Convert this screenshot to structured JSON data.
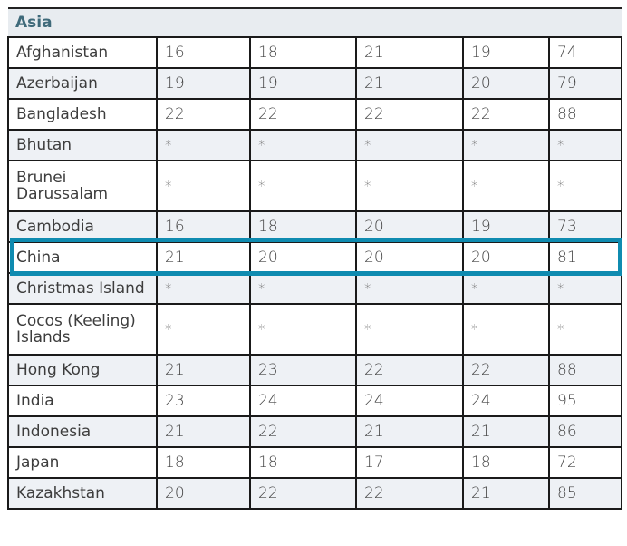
{
  "section_title": "Asia",
  "highlight_color": "#0f8bb0",
  "rows": [
    {
      "name": "Afghanistan",
      "values": [
        "16",
        "18",
        "21",
        "19",
        "74"
      ]
    },
    {
      "name": "Azerbaijan",
      "values": [
        "19",
        "19",
        "21",
        "20",
        "79"
      ]
    },
    {
      "name": "Bangladesh",
      "values": [
        "22",
        "22",
        "22",
        "22",
        "88"
      ]
    },
    {
      "name": "Bhutan",
      "values": [
        "*",
        "*",
        "*",
        "*",
        "*"
      ]
    },
    {
      "name": "Brunei Darussalam",
      "values": [
        "*",
        "*",
        "*",
        "*",
        "*"
      ]
    },
    {
      "name": "Cambodia",
      "values": [
        "16",
        "18",
        "20",
        "19",
        "73"
      ]
    },
    {
      "name": "China",
      "values": [
        "21",
        "20",
        "20",
        "20",
        "81"
      ],
      "highlighted": true
    },
    {
      "name": "Christmas Island",
      "values": [
        "*",
        "*",
        "*",
        "*",
        "*"
      ]
    },
    {
      "name": "Cocos (Keeling) Islands",
      "values": [
        "*",
        "*",
        "*",
        "*",
        "*"
      ]
    },
    {
      "name": "Hong Kong",
      "values": [
        "21",
        "23",
        "22",
        "22",
        "88"
      ]
    },
    {
      "name": "India",
      "values": [
        "23",
        "24",
        "24",
        "24",
        "95"
      ]
    },
    {
      "name": "Indonesia",
      "values": [
        "21",
        "22",
        "21",
        "21",
        "86"
      ]
    },
    {
      "name": "Japan",
      "values": [
        "18",
        "18",
        "17",
        "18",
        "72"
      ]
    },
    {
      "name": "Kazakhstan",
      "values": [
        "20",
        "22",
        "22",
        "21",
        "85"
      ]
    }
  ]
}
